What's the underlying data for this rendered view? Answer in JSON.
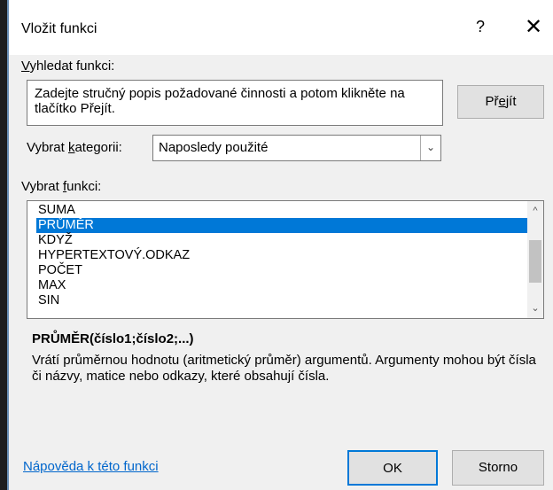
{
  "window": {
    "title": "Vložit funkci",
    "help_glyph": "?",
    "close_glyph": "✕"
  },
  "search": {
    "label_ul": "V",
    "label_rest": "yhledat funkci:",
    "box_text": "Zadejte stručný popis požadované činnosti a potom klikněte na tlačítko Přejít.",
    "go_button_pre": "Př",
    "go_button_ul": "e",
    "go_button_post": "jít"
  },
  "category": {
    "label_pre": "Vybrat ",
    "label_ul": "k",
    "label_post": "ategorii:",
    "selected": "Naposledy použité",
    "arrow_glyph": "⌄"
  },
  "functions": {
    "label_pre": "Vybrat ",
    "label_ul": "f",
    "label_post": "unkci:",
    "items": [
      "SUMA",
      "PRŮMĚR",
      "KDYŽ",
      "HYPERTEXTOVÝ.ODKAZ",
      "POČET",
      "MAX",
      "SIN"
    ],
    "selected_index": 1,
    "scroll_up_glyph": "^",
    "scroll_down_glyph": "⌄"
  },
  "details": {
    "signature": "PRŮMĚR(číslo1;číslo2;...)",
    "description": "Vrátí průměrnou hodnotu (aritmetický průměr) argumentů. Argumenty mohou být čísla či názvy, matice nebo odkazy, které obsahují čísla."
  },
  "footer": {
    "help_link": "Nápověda k této funkci",
    "ok_label": "OK",
    "cancel_label": "Storno"
  },
  "colors": {
    "selection": "#0078d7",
    "link": "#0066cc",
    "dialog_bg": "#f0f0f0"
  }
}
